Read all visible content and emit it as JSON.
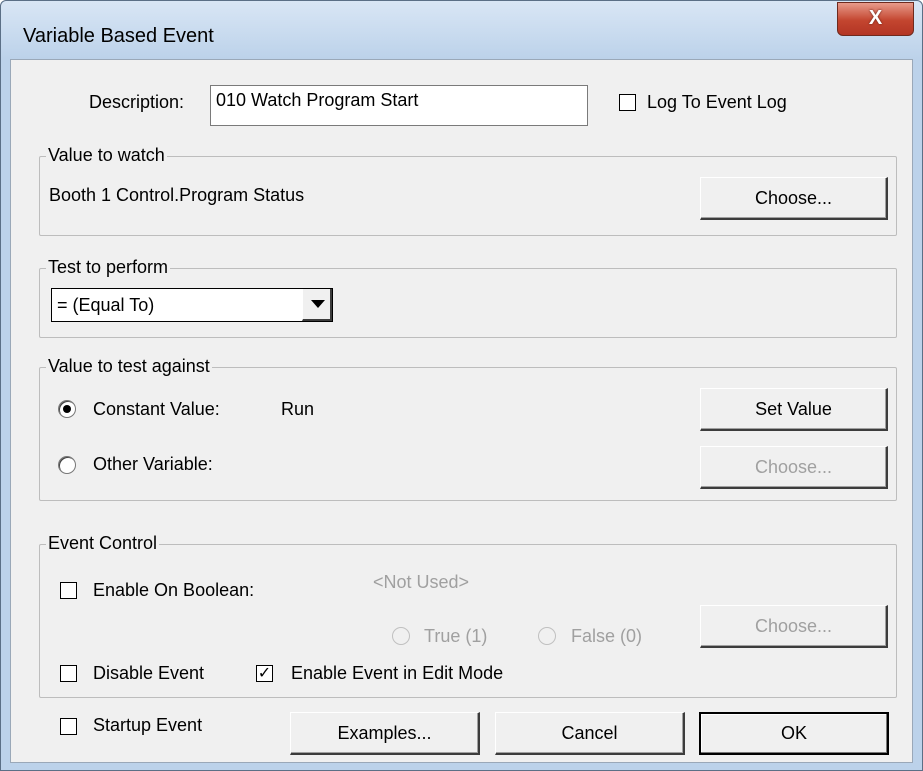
{
  "window": {
    "title": "Variable Based Event",
    "close_glyph": "X"
  },
  "description": {
    "label": "Description:",
    "value": "010 Watch Program Start"
  },
  "log_to_event_log": {
    "label": "Log To Event Log",
    "checked": false
  },
  "value_to_watch": {
    "title": "Value to watch",
    "value": "Booth 1 Control.Program Status",
    "choose_label": "Choose..."
  },
  "test_to_perform": {
    "title": "Test to perform",
    "selected": "= (Equal To)"
  },
  "value_to_test_against": {
    "title": "Value to test against",
    "constant": {
      "label": "Constant Value:",
      "value": "Run",
      "selected": true
    },
    "other": {
      "label": "Other Variable:",
      "selected": false
    },
    "set_value_label": "Set Value",
    "choose_label": "Choose..."
  },
  "event_control": {
    "title": "Event Control",
    "enable_on_boolean": {
      "label": "Enable On Boolean:",
      "checked": false,
      "value": "<Not Used>"
    },
    "true_label": "True (1)",
    "false_label": "False (0)",
    "choose_label": "Choose...",
    "disable_event": {
      "label": "Disable Event",
      "checked": false
    },
    "enable_in_edit_mode": {
      "label": "Enable Event in Edit Mode",
      "checked": true
    }
  },
  "footer": {
    "startup_event": {
      "label": "Startup Event",
      "checked": false
    },
    "examples_label": "Examples...",
    "cancel_label": "Cancel",
    "ok_label": "OK"
  },
  "colors": {
    "title_bar": "#bcd2ea",
    "close_button": "#c3452f",
    "client_bg": "#f0f0f0"
  }
}
